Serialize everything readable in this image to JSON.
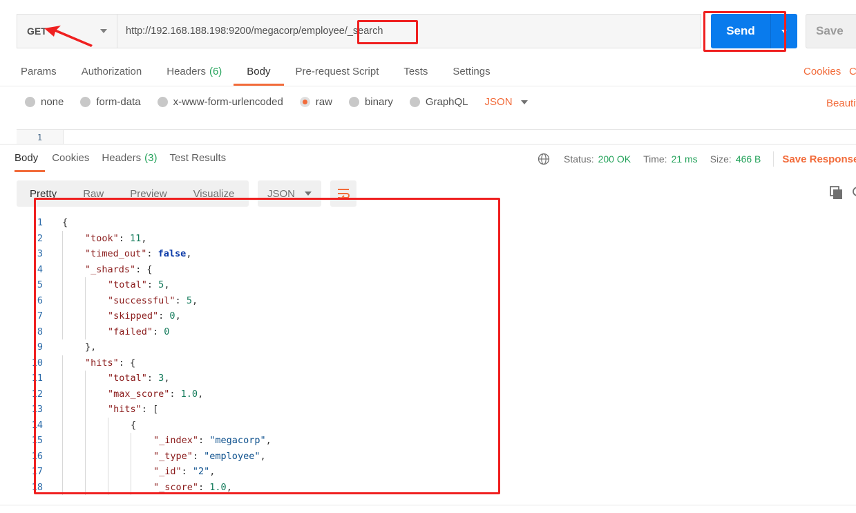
{
  "request": {
    "method": "GET",
    "url": "http://192.168.188.198:9200/megacorp/employee/_search",
    "send_label": "Send",
    "save_label": "Save"
  },
  "request_tabs": [
    {
      "label": "Params"
    },
    {
      "label": "Authorization"
    },
    {
      "label": "Headers",
      "count": "(6)"
    },
    {
      "label": "Body",
      "active": true
    },
    {
      "label": "Pre-request Script"
    },
    {
      "label": "Tests"
    },
    {
      "label": "Settings"
    }
  ],
  "request_links": {
    "cookies": "Cookies",
    "code": "C",
    "beautify": "Beautif"
  },
  "body_types": [
    "none",
    "form-data",
    "x-www-form-urlencoded",
    "raw",
    "binary",
    "GraphQL"
  ],
  "body_selected": "raw",
  "body_format": "JSON",
  "editor_line": "1",
  "response_tabs": [
    {
      "label": "Body",
      "active": true
    },
    {
      "label": "Cookies"
    },
    {
      "label": "Headers",
      "count": "(3)"
    },
    {
      "label": "Test Results"
    }
  ],
  "response_meta": {
    "status_label": "Status:",
    "status_value": "200 OK",
    "time_label": "Time:",
    "time_value": "21 ms",
    "size_label": "Size:",
    "size_value": "466 B",
    "save_response": "Save Response"
  },
  "view_modes": [
    "Pretty",
    "Raw",
    "Preview",
    "Visualize"
  ],
  "view_format": "JSON",
  "icons": [
    "globe-icon",
    "wrap-lines-icon",
    "copy-icon",
    "search-icon",
    "chevron-down-icon"
  ],
  "colors": {
    "accent": "#f26b3a",
    "send": "#097bed",
    "status_ok": "#26a35c",
    "annotation": "#ef2020"
  },
  "response_body": [
    {
      "n": "1",
      "indent": 0,
      "parts": [
        [
          "p",
          "{"
        ]
      ]
    },
    {
      "n": "2",
      "indent": 1,
      "parts": [
        [
          "k",
          "\"took\""
        ],
        [
          "p",
          ": "
        ],
        [
          "n",
          "11"
        ],
        [
          "p",
          ","
        ]
      ]
    },
    {
      "n": "3",
      "indent": 1,
      "parts": [
        [
          "k",
          "\"timed_out\""
        ],
        [
          "p",
          ": "
        ],
        [
          "b",
          "false"
        ],
        [
          "p",
          ","
        ]
      ]
    },
    {
      "n": "4",
      "indent": 1,
      "parts": [
        [
          "k",
          "\"_shards\""
        ],
        [
          "p",
          ": {"
        ]
      ]
    },
    {
      "n": "5",
      "indent": 2,
      "parts": [
        [
          "k",
          "\"total\""
        ],
        [
          "p",
          ": "
        ],
        [
          "n",
          "5"
        ],
        [
          "p",
          ","
        ]
      ]
    },
    {
      "n": "6",
      "indent": 2,
      "parts": [
        [
          "k",
          "\"successful\""
        ],
        [
          "p",
          ": "
        ],
        [
          "n",
          "5"
        ],
        [
          "p",
          ","
        ]
      ]
    },
    {
      "n": "7",
      "indent": 2,
      "parts": [
        [
          "k",
          "\"skipped\""
        ],
        [
          "p",
          ": "
        ],
        [
          "n",
          "0"
        ],
        [
          "p",
          ","
        ]
      ]
    },
    {
      "n": "8",
      "indent": 2,
      "parts": [
        [
          "k",
          "\"failed\""
        ],
        [
          "p",
          ": "
        ],
        [
          "n",
          "0"
        ]
      ]
    },
    {
      "n": "9",
      "indent": 1,
      "parts": [
        [
          "p",
          "},"
        ]
      ]
    },
    {
      "n": "10",
      "indent": 1,
      "parts": [
        [
          "k",
          "\"hits\""
        ],
        [
          "p",
          ": {"
        ]
      ]
    },
    {
      "n": "11",
      "indent": 2,
      "parts": [
        [
          "k",
          "\"total\""
        ],
        [
          "p",
          ": "
        ],
        [
          "n",
          "3"
        ],
        [
          "p",
          ","
        ]
      ]
    },
    {
      "n": "12",
      "indent": 2,
      "parts": [
        [
          "k",
          "\"max_score\""
        ],
        [
          "p",
          ": "
        ],
        [
          "n",
          "1.0"
        ],
        [
          "p",
          ","
        ]
      ]
    },
    {
      "n": "13",
      "indent": 2,
      "parts": [
        [
          "k",
          "\"hits\""
        ],
        [
          "p",
          ": ["
        ]
      ]
    },
    {
      "n": "14",
      "indent": 3,
      "parts": [
        [
          "p",
          "{"
        ]
      ]
    },
    {
      "n": "15",
      "indent": 4,
      "parts": [
        [
          "k",
          "\"_index\""
        ],
        [
          "p",
          ": "
        ],
        [
          "s",
          "\"megacorp\""
        ],
        [
          "p",
          ","
        ]
      ]
    },
    {
      "n": "16",
      "indent": 4,
      "parts": [
        [
          "k",
          "\"_type\""
        ],
        [
          "p",
          ": "
        ],
        [
          "s",
          "\"employee\""
        ],
        [
          "p",
          ","
        ]
      ]
    },
    {
      "n": "17",
      "indent": 4,
      "parts": [
        [
          "k",
          "\"_id\""
        ],
        [
          "p",
          ": "
        ],
        [
          "s",
          "\"2\""
        ],
        [
          "p",
          ","
        ]
      ]
    },
    {
      "n": "18",
      "indent": 4,
      "parts": [
        [
          "k",
          "\"_score\""
        ],
        [
          "p",
          ": "
        ],
        [
          "n",
          "1.0"
        ],
        [
          "p",
          ","
        ]
      ]
    }
  ]
}
